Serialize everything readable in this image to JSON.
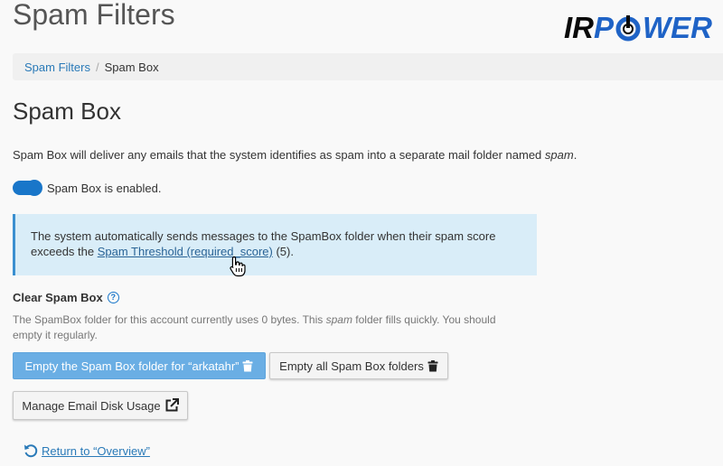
{
  "page": {
    "title": "Spam Filters"
  },
  "logo": {
    "part1": "IR",
    "part2": "P",
    "part3": "WER"
  },
  "breadcrumb": {
    "parent": "Spam Filters",
    "separator": "/",
    "current": "Spam Box"
  },
  "section": {
    "title": "Spam Box",
    "description_before": "Spam Box will deliver any emails that the system identifies as spam into a separate mail folder named ",
    "description_em": "spam",
    "description_after": "."
  },
  "toggle": {
    "label": "Spam Box is enabled.",
    "enabled": true
  },
  "info": {
    "text_line1": "The system automatically sends messages to the SpamBox folder when their spam score",
    "text_line2_before": "exceeds the ",
    "link": "Spam Threshold (required_score)",
    "text_line2_after": " (5)."
  },
  "clear": {
    "title": "Clear Spam Box",
    "help_icon": "question-circle-icon",
    "note_before": "The SpamBox folder for this account currently uses 0 bytes. This ",
    "note_em": "spam",
    "note_after": " folder fills quickly. You should empty it regularly."
  },
  "buttons": {
    "empty_account": "Empty the Spam Box folder for “arkatahr”",
    "empty_all": "Empty all Spam Box folders",
    "manage_disk": "Manage Email Disk Usage"
  },
  "return": {
    "label": "Return to “Overview”"
  },
  "colors": {
    "accent": "#1976c9",
    "link": "#2a7ab8",
    "info_bg": "#d9edf8",
    "primary_button": "#6aaee4"
  }
}
